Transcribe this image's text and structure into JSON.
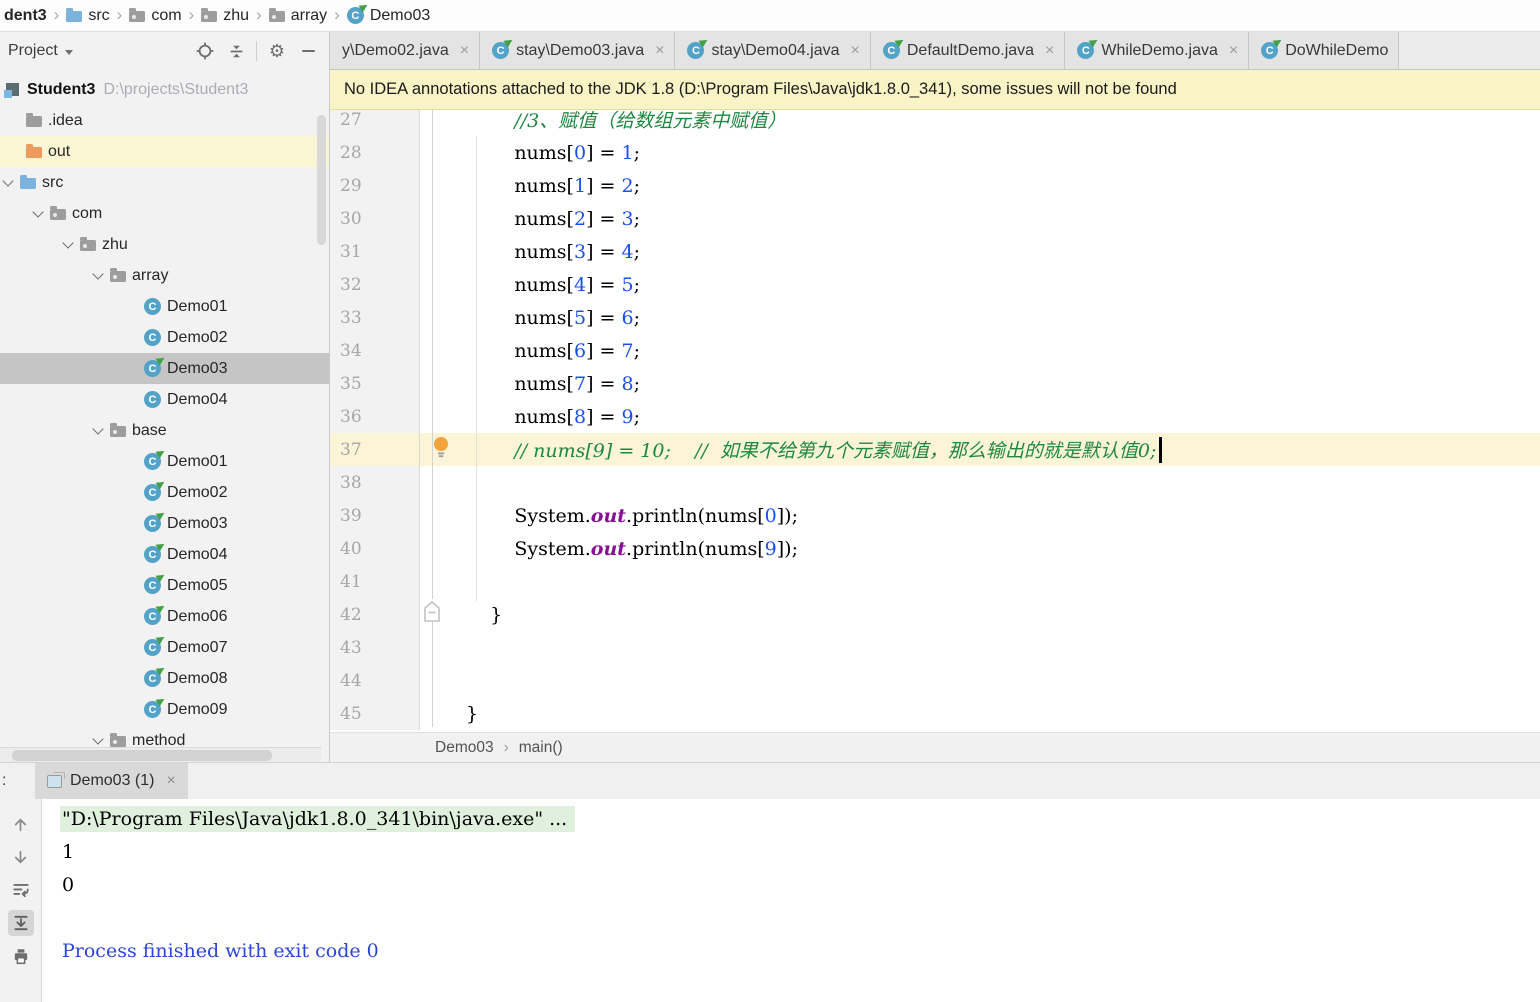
{
  "colors": {
    "accent_class_blue": "#53a3c8",
    "run_green": "#43a047",
    "folder_blue": "#7cb3dc",
    "folder_gray": "#9d9d9d",
    "folder_orange": "#ec9a5e",
    "comment_green": "#1d8840",
    "number_blue": "#1750eb",
    "field_purple": "#871094",
    "console_info_blue": "#2b46d5",
    "banner_bg": "#f9f4c6",
    "current_line_bg": "#fbf4d6",
    "selection_gray": "#c5c5c5",
    "out_row_bg": "#faf5d2",
    "cmd_bg_green": "#dff1dc",
    "bulb_orange": "#f2a33d"
  },
  "top_breadcrumb": {
    "items": [
      {
        "label": "dent3",
        "bold": true
      },
      {
        "label": "src",
        "icon": "folder-blue"
      },
      {
        "label": "com",
        "icon": "package"
      },
      {
        "label": "zhu",
        "icon": "package"
      },
      {
        "label": "array",
        "icon": "package"
      },
      {
        "label": "Demo03",
        "icon": "class-run"
      }
    ]
  },
  "project_panel": {
    "title": "Project",
    "tree": [
      {
        "icon": "module",
        "label": "Student3",
        "path": "D:\\projects\\Student3",
        "pad": 6,
        "root": true
      },
      {
        "icon": "folder-gray",
        "label": ".idea",
        "pad": 26
      },
      {
        "icon": "folder-orange",
        "label": "out",
        "pad": 26,
        "hl": true
      },
      {
        "icon": "folder-blue",
        "label": "src",
        "pad": 2,
        "chevron": true
      },
      {
        "icon": "package",
        "label": "com",
        "pad": 32,
        "chevron": true
      },
      {
        "icon": "package",
        "label": "zhu",
        "pad": 62,
        "chevron": true
      },
      {
        "icon": "package",
        "label": "array",
        "pad": 92,
        "chevron": true
      },
      {
        "icon": "class",
        "label": "Demo01",
        "pad": 144
      },
      {
        "icon": "class",
        "label": "Demo02",
        "pad": 144
      },
      {
        "icon": "class-run",
        "label": "Demo03",
        "pad": 144,
        "selected": true
      },
      {
        "icon": "class",
        "label": "Demo04",
        "pad": 144
      },
      {
        "icon": "package",
        "label": "base",
        "pad": 92,
        "chevron": true
      },
      {
        "icon": "class-run",
        "label": "Demo01",
        "pad": 144
      },
      {
        "icon": "class-run",
        "label": "Demo02",
        "pad": 144
      },
      {
        "icon": "class-run",
        "label": "Demo03",
        "pad": 144
      },
      {
        "icon": "class-run",
        "label": "Demo04",
        "pad": 144
      },
      {
        "icon": "class-run",
        "label": "Demo05",
        "pad": 144
      },
      {
        "icon": "class-run",
        "label": "Demo06",
        "pad": 144
      },
      {
        "icon": "class-run",
        "label": "Demo07",
        "pad": 144
      },
      {
        "icon": "class-run",
        "label": "Demo08",
        "pad": 144
      },
      {
        "icon": "class-run",
        "label": "Demo09",
        "pad": 144
      },
      {
        "icon": "package",
        "label": "method",
        "pad": 92,
        "chevron": true
      }
    ]
  },
  "editor_tabs": [
    {
      "label": "y\\Demo02.java",
      "icon": false,
      "first": true
    },
    {
      "label": "stay\\Demo03.java",
      "icon": true
    },
    {
      "label": "stay\\Demo04.java",
      "icon": true
    },
    {
      "label": "DefaultDemo.java",
      "icon": true
    },
    {
      "label": "WhileDemo.java",
      "icon": true
    },
    {
      "label": "DoWhileDemo",
      "icon": true,
      "noclose": true
    }
  ],
  "banner": {
    "text": "No IDEA annotations attached to the JDK 1.8 (D:\\Program Files\\Java\\jdk1.8.0_341), some issues will not be found"
  },
  "editor": {
    "lines": [
      {
        "n": "27",
        "t": [
          [
            "c",
            "        //3、赋值（给数组元素中赋值）"
          ]
        ]
      },
      {
        "n": "28",
        "t": [
          [
            "p",
            "        nums["
          ],
          [
            "d",
            "0"
          ],
          [
            "p",
            "] = "
          ],
          [
            "d",
            "1"
          ],
          [
            "p",
            ";"
          ]
        ]
      },
      {
        "n": "29",
        "t": [
          [
            "p",
            "        nums["
          ],
          [
            "d",
            "1"
          ],
          [
            "p",
            "] = "
          ],
          [
            "d",
            "2"
          ],
          [
            "p",
            ";"
          ]
        ]
      },
      {
        "n": "30",
        "t": [
          [
            "p",
            "        nums["
          ],
          [
            "d",
            "2"
          ],
          [
            "p",
            "] = "
          ],
          [
            "d",
            "3"
          ],
          [
            "p",
            ";"
          ]
        ]
      },
      {
        "n": "31",
        "t": [
          [
            "p",
            "        nums["
          ],
          [
            "d",
            "3"
          ],
          [
            "p",
            "] = "
          ],
          [
            "d",
            "4"
          ],
          [
            "p",
            ";"
          ]
        ]
      },
      {
        "n": "32",
        "t": [
          [
            "p",
            "        nums["
          ],
          [
            "d",
            "4"
          ],
          [
            "p",
            "] = "
          ],
          [
            "d",
            "5"
          ],
          [
            "p",
            ";"
          ]
        ]
      },
      {
        "n": "33",
        "t": [
          [
            "p",
            "        nums["
          ],
          [
            "d",
            "5"
          ],
          [
            "p",
            "] = "
          ],
          [
            "d",
            "6"
          ],
          [
            "p",
            ";"
          ]
        ]
      },
      {
        "n": "34",
        "t": [
          [
            "p",
            "        nums["
          ],
          [
            "d",
            "6"
          ],
          [
            "p",
            "] = "
          ],
          [
            "d",
            "7"
          ],
          [
            "p",
            ";"
          ]
        ]
      },
      {
        "n": "35",
        "t": [
          [
            "p",
            "        nums["
          ],
          [
            "d",
            "7"
          ],
          [
            "p",
            "] = "
          ],
          [
            "d",
            "8"
          ],
          [
            "p",
            ";"
          ]
        ]
      },
      {
        "n": "36",
        "t": [
          [
            "p",
            "        nums["
          ],
          [
            "d",
            "8"
          ],
          [
            "p",
            "] = "
          ],
          [
            "d",
            "9"
          ],
          [
            "p",
            ";"
          ]
        ]
      },
      {
        "n": "37",
        "t": [
          [
            "c",
            "        // nums[9] = 10;    //  如果不给第九个元素赋值，那么输出的就是默认值0;"
          ]
        ],
        "current": true,
        "bulb": true,
        "caret": true
      },
      {
        "n": "38",
        "t": []
      },
      {
        "n": "39",
        "t": [
          [
            "p",
            "        System."
          ],
          [
            "f",
            "out"
          ],
          [
            "p",
            ".println(nums["
          ],
          [
            "d",
            "0"
          ],
          [
            "p",
            "]);"
          ]
        ]
      },
      {
        "n": "40",
        "t": [
          [
            "p",
            "        System."
          ],
          [
            "f",
            "out"
          ],
          [
            "p",
            ".println(nums["
          ],
          [
            "d",
            "9"
          ],
          [
            "p",
            "]);"
          ]
        ]
      },
      {
        "n": "41",
        "t": []
      },
      {
        "n": "42",
        "t": [
          [
            "p",
            "    }"
          ]
        ],
        "fold": true
      },
      {
        "n": "43",
        "t": []
      },
      {
        "n": "44",
        "t": []
      },
      {
        "n": "45",
        "t": [
          [
            "p",
            "}"
          ]
        ]
      }
    ],
    "breadcrumb": {
      "file": "Demo03",
      "method": "main()"
    }
  },
  "console": {
    "left_label": ":",
    "tab": "Demo03 (1)",
    "lines": [
      {
        "text": "\"D:\\Program Files\\Java\\jdk1.8.0_341\\bin\\java.exe\" ...",
        "style": "cmd"
      },
      {
        "text": "1",
        "style": "plain"
      },
      {
        "text": "0",
        "style": "plain"
      },
      {
        "text": "",
        "style": "plain"
      },
      {
        "text": "Process finished with exit code 0",
        "style": "info"
      }
    ]
  }
}
